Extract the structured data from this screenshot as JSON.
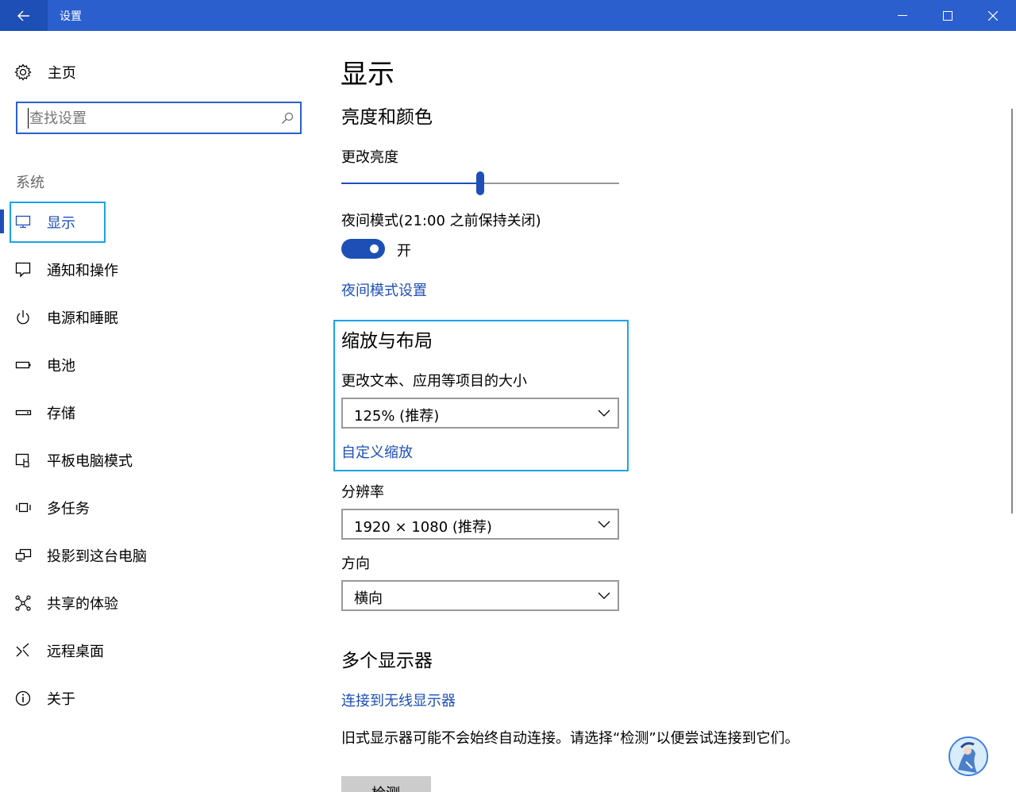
{
  "titlebar": {
    "title": "设置"
  },
  "sidebar": {
    "home_label": "主页",
    "search_placeholder": "查找设置",
    "section_label": "系统",
    "items": [
      {
        "label": "显示",
        "icon": "monitor-icon"
      },
      {
        "label": "通知和操作",
        "icon": "notification-icon"
      },
      {
        "label": "电源和睡眠",
        "icon": "power-icon"
      },
      {
        "label": "电池",
        "icon": "battery-icon"
      },
      {
        "label": "存储",
        "icon": "storage-icon"
      },
      {
        "label": "平板电脑模式",
        "icon": "tablet-mode-icon"
      },
      {
        "label": "多任务",
        "icon": "multitasking-icon"
      },
      {
        "label": "投影到这台电脑",
        "icon": "project-icon"
      },
      {
        "label": "共享的体验",
        "icon": "shared-experiences-icon"
      },
      {
        "label": "远程桌面",
        "icon": "remote-desktop-icon"
      },
      {
        "label": "关于",
        "icon": "info-icon"
      }
    ]
  },
  "main": {
    "page_title": "显示",
    "brightness_section": "亮度和颜色",
    "brightness_label": "更改亮度",
    "brightness_value": 0.5,
    "night_light_label": "夜间模式(21:00 之前保持关闭)",
    "night_light_state": "开",
    "night_light_link": "夜间模式设置",
    "scale_section": "缩放与布局",
    "scale_label": "更改文本、应用等项目的大小",
    "scale_value": "125% (推荐)",
    "custom_scale_link": "自定义缩放",
    "resolution_label": "分辨率",
    "resolution_value": "1920 × 1080 (推荐)",
    "orientation_label": "方向",
    "orientation_value": "横向",
    "multi_display_section": "多个显示器",
    "wireless_link": "连接到无线显示器",
    "detect_desc": "旧式显示器可能不会始终自动连接。请选择“检测”以便尝试连接到它们。",
    "detect_button": "检测"
  },
  "colors": {
    "accent": "#1e4fb7",
    "titlebar": "#2b5fce",
    "focus": "#1aa3e8"
  }
}
